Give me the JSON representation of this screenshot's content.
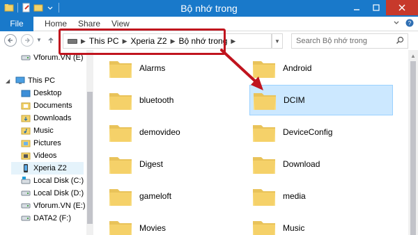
{
  "window": {
    "title": "Bộ nhớ trong"
  },
  "ribbon": {
    "tabs": [
      "File",
      "Home",
      "Share",
      "View"
    ]
  },
  "address": {
    "crumbs": [
      "This PC",
      "Xperia Z2",
      "Bộ nhớ trong"
    ],
    "search_placeholder": "Search Bộ nhớ trong"
  },
  "nav": {
    "items": [
      {
        "label": "Vforum.VN (E)",
        "icon": "drive-icon"
      },
      {
        "label": "This PC",
        "icon": "computer-icon"
      },
      {
        "label": "Desktop",
        "icon": "folder-icon"
      },
      {
        "label": "Documents",
        "icon": "folder-icon"
      },
      {
        "label": "Downloads",
        "icon": "folder-icon"
      },
      {
        "label": "Music",
        "icon": "folder-icon"
      },
      {
        "label": "Pictures",
        "icon": "folder-icon"
      },
      {
        "label": "Videos",
        "icon": "folder-icon"
      },
      {
        "label": "Xperia Z2",
        "icon": "phone-icon"
      },
      {
        "label": "Local Disk (C:)",
        "icon": "drive-icon"
      },
      {
        "label": "Local Disk (D:)",
        "icon": "drive-icon"
      },
      {
        "label": "Vforum.VN (E:)",
        "icon": "drive-icon"
      },
      {
        "label": "DATA2 (F:)",
        "icon": "drive-icon"
      }
    ]
  },
  "folders": {
    "left": [
      "Alarms",
      "bluetooth",
      "demovideo",
      "Digest",
      "gameloft",
      "Movies"
    ],
    "right": [
      "Android",
      "DCIM",
      "DeviceConfig",
      "Download",
      "media",
      "Music"
    ],
    "selected": "DCIM"
  },
  "colors": {
    "accent": "#1979ca",
    "highlight": "#c0141e",
    "selection": "#cce8ff"
  }
}
